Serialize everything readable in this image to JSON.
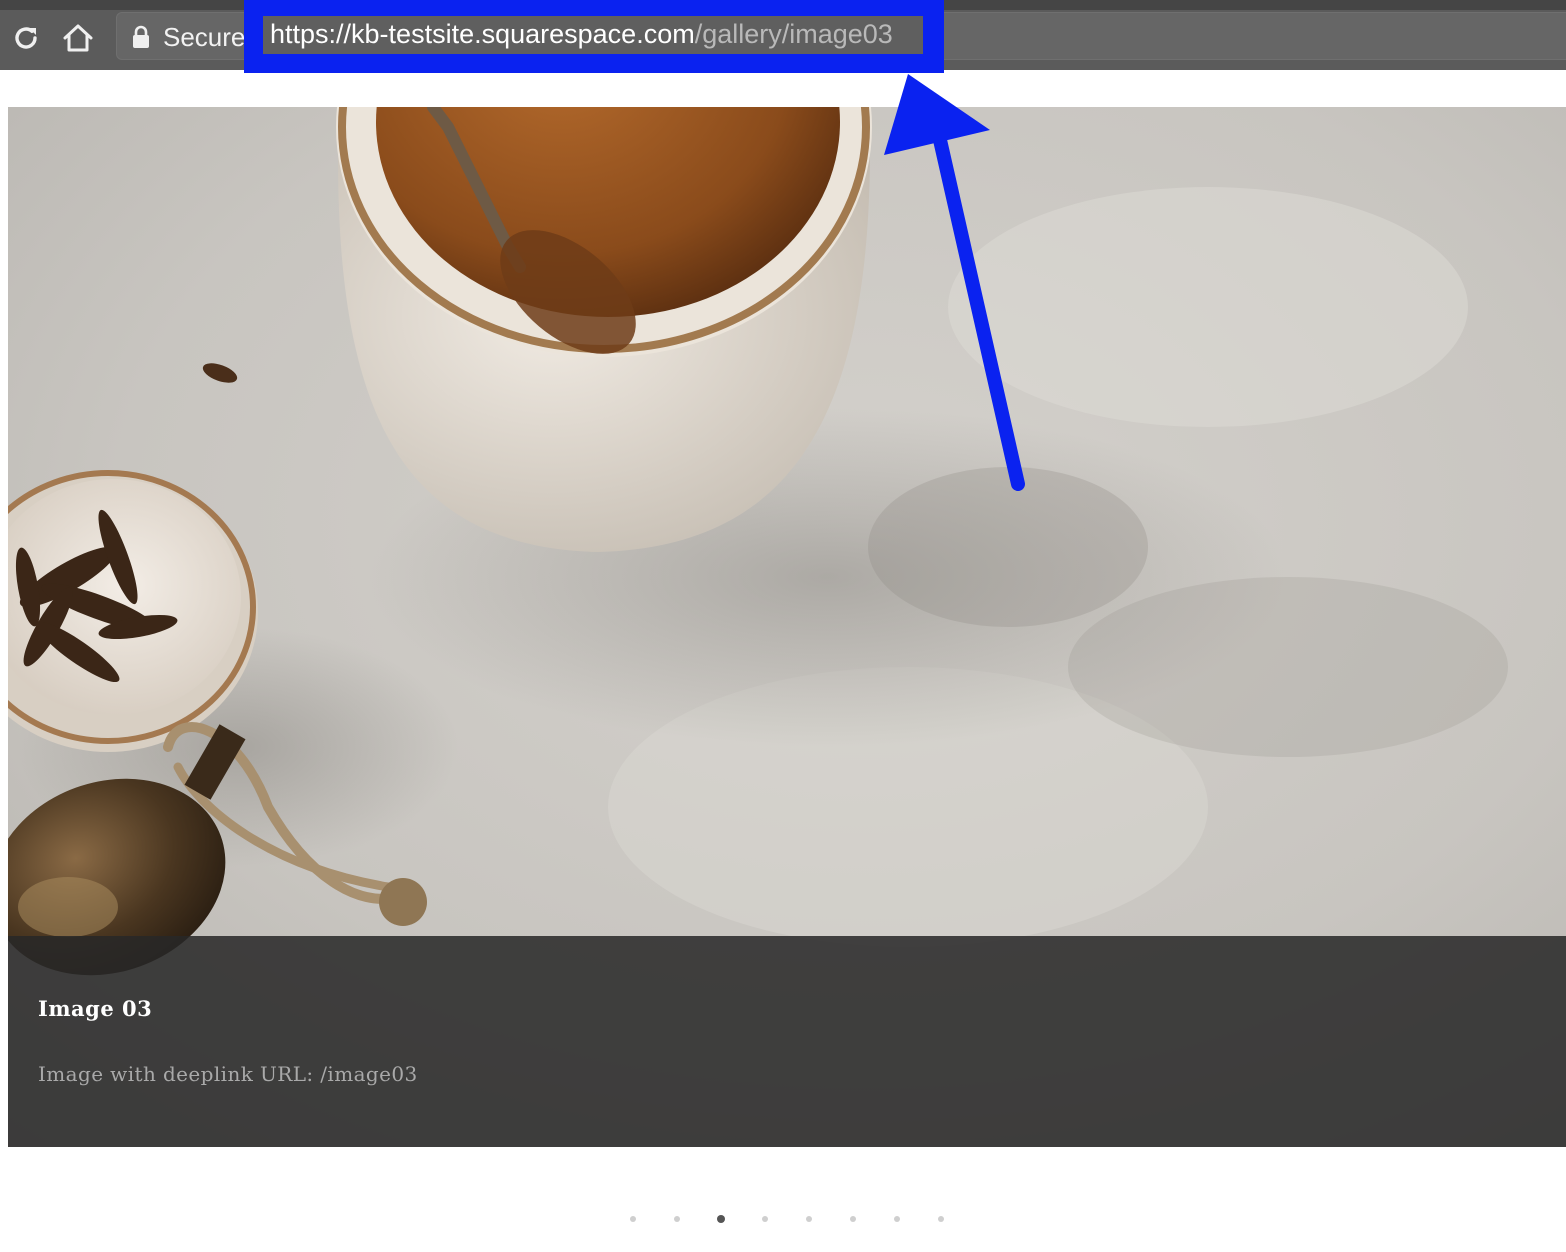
{
  "browser": {
    "secure_label": "Secure",
    "url": {
      "strong_part": "https://kb-testsite.squarespace.com",
      "dim_part": "/gallery/image03"
    },
    "highlight_color": "#0a22f0",
    "icons": [
      "reload-icon",
      "home-icon",
      "lock-icon"
    ]
  },
  "slide": {
    "title": "Image 03",
    "description": "Image with deeplink URL: /image03"
  },
  "pagination": {
    "count": 8,
    "active_index": 2
  }
}
